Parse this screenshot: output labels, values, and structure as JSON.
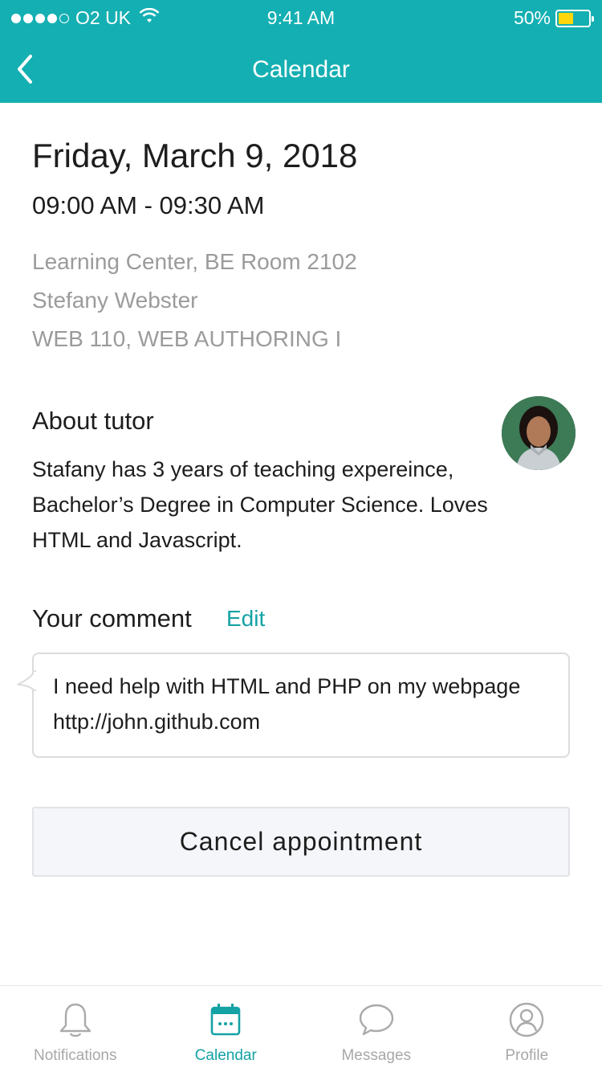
{
  "status_bar": {
    "carrier": "O2 UK",
    "time": "9:41 AM",
    "battery": "50%"
  },
  "nav": {
    "title": "Calendar",
    "back_icon": "chevron-left-icon"
  },
  "appointment": {
    "date": "Friday, March 9, 2018",
    "time_range": "09:00 AM - 09:30 AM",
    "location": "Learning Center, BE Room 2102",
    "tutor": "Stefany Webster",
    "course": "WEB 110, WEB AUTHORING I"
  },
  "about": {
    "title": "About tutor",
    "text": "Stafany has 3 years of teaching expereince, Bachelor’s Degree in Computer Science. Loves HTML and Javascript."
  },
  "comment": {
    "title": "Your comment",
    "edit_label": "Edit",
    "text": "I need help with HTML and PHP on my webpage http://john.github.com"
  },
  "actions": {
    "cancel_label": "Cancel appointment"
  },
  "tabs": [
    {
      "label": "Notifications",
      "icon": "bell-icon"
    },
    {
      "label": "Calendar",
      "icon": "calendar-icon"
    },
    {
      "label": "Messages",
      "icon": "chat-bubble-icon"
    },
    {
      "label": "Profile",
      "icon": "user-circle-icon"
    }
  ],
  "colors": {
    "accent": "#14afb2",
    "link": "#14a2a5",
    "muted": "#9b9b9b"
  }
}
